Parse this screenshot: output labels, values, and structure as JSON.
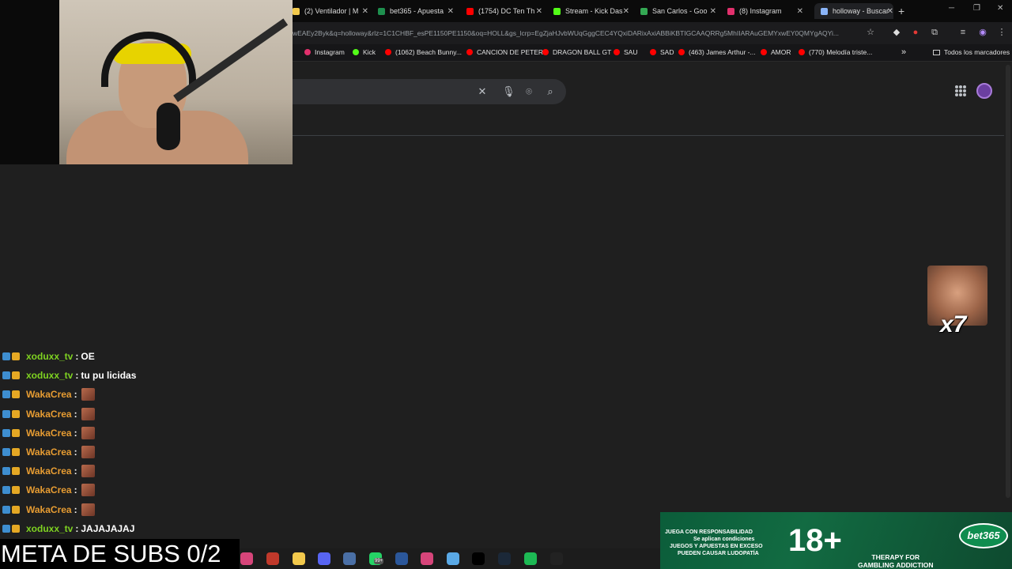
{
  "browser": {
    "tabs": [
      {
        "title": "(2) Ventilador | M",
        "icon": "generic-icon",
        "color": "#f2c94c"
      },
      {
        "title": "bet365 - Apuesta",
        "icon": "bet365-icon",
        "color": "#1e8f4e"
      },
      {
        "title": "(1754) DC Ten Th",
        "icon": "youtube-icon",
        "color": "#ff0000"
      },
      {
        "title": "Stream - Kick Das",
        "icon": "kick-icon",
        "color": "#53fc18"
      },
      {
        "title": "San Carlos - Goo",
        "icon": "maps-icon",
        "color": "#34a853"
      },
      {
        "title": "(8) Instagram",
        "icon": "instagram-icon",
        "color": "#e1306c"
      },
      {
        "title": "holloway - Buscar",
        "icon": "loading-icon",
        "color": "#8ab4f8",
        "active": true
      }
    ],
    "url": "wEAEy2Byk&q=holloway&rlz=1C1CHBF_esPE1150PE1150&oq=HOLL&gs_lcrp=EgZjaHJvbWUqGggCEC4YQxiDARixAxiABBiKBTIGCAAQRRg5MhIIARAuGEMYxwEY0QMYgAQYi...",
    "bookmarks": [
      {
        "label": "Instagram",
        "color": "#e1306c"
      },
      {
        "label": "Kick",
        "color": "#53fc18"
      },
      {
        "label": "(1062) Beach Bunny...",
        "color": "#ff0000"
      },
      {
        "label": "CANCION DE PETER",
        "color": "#ff0000"
      },
      {
        "label": "DRAGON BALL GT",
        "color": "#ff0000"
      },
      {
        "label": "SAU",
        "color": "#ff0000"
      },
      {
        "label": "SAD",
        "color": "#ff0000"
      },
      {
        "label": "(463) James Arthur -...",
        "color": "#ff0000"
      },
      {
        "label": "AMOR",
        "color": "#ff0000"
      },
      {
        "label": "(770) Melodía triste...",
        "color": "#ff0000"
      }
    ],
    "bookmarks_more": "»",
    "all_bookmarks": "Todos los marcadores"
  },
  "chat": [
    {
      "user": "xoduxx_tv",
      "color": "#7fd321",
      "message": "OE"
    },
    {
      "user": "xoduxx_tv",
      "color": "#7fd321",
      "message": "tu pu licidas"
    },
    {
      "user": "WakaCrea",
      "color": "#e79c32",
      "emote": true
    },
    {
      "user": "WakaCrea",
      "color": "#e79c32",
      "emote": true
    },
    {
      "user": "WakaCrea",
      "color": "#e79c32",
      "emote": true
    },
    {
      "user": "WakaCrea",
      "color": "#e79c32",
      "emote": true
    },
    {
      "user": "WakaCrea",
      "color": "#e79c32",
      "emote": true
    },
    {
      "user": "WakaCrea",
      "color": "#e79c32",
      "emote": true
    },
    {
      "user": "WakaCrea",
      "color": "#e79c32",
      "emote": true
    },
    {
      "user": "xoduxx_tv",
      "color": "#7fd321",
      "message": "JAJAJAJAJ"
    }
  ],
  "chat_separator": ":",
  "meta_subs": "META DE SUBS 0/2",
  "emote_overlay": {
    "multiplier": "x7"
  },
  "ad": {
    "line1": "JUEGA CON RESPONSABILIDAD",
    "line2": "Se aplican condiciones",
    "line3": "JUEGOS Y APUESTAS EN EXCESO",
    "line4": "PUEDEN CAUSAR LUDOPATÍA",
    "age": "18+",
    "brand": "bet365",
    "therapy_1": "THERAPY FOR",
    "therapy_2": "GAMBLING ADDICTION"
  },
  "taskbar": {
    "icons": [
      "app-pink-icon",
      "app-red-icon",
      "chrome-icon",
      "discord-icon",
      "calculator-icon",
      "whatsapp-icon",
      "word-icon",
      "app-pink2-icon",
      "files-icon",
      "tiktok-icon",
      "steam-icon",
      "spotify-icon",
      "obs-icon"
    ],
    "whatsapp_badge": "99+"
  }
}
